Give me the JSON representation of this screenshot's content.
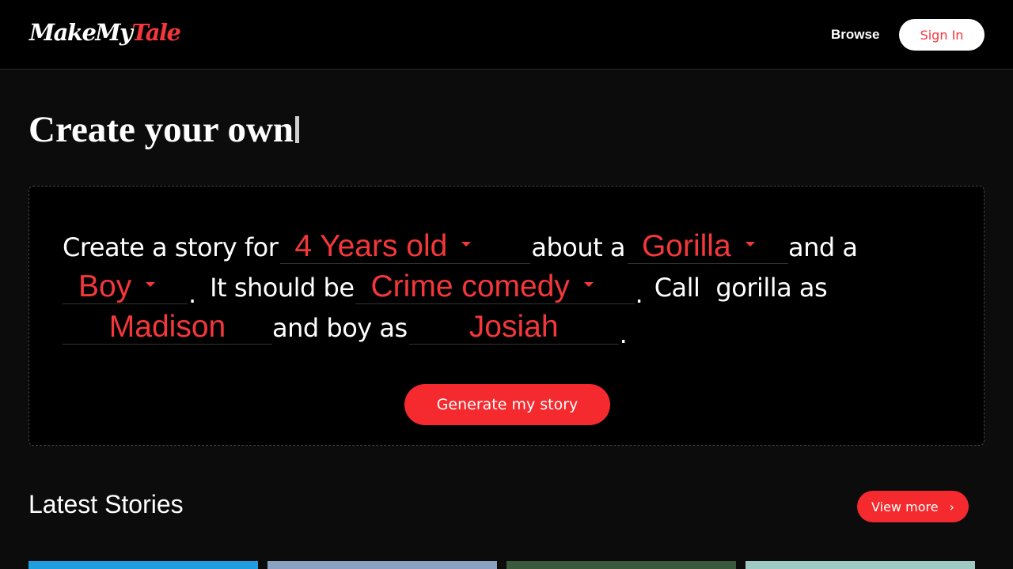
{
  "header": {
    "logo_part1": "MakeMy",
    "logo_part2": "Tale",
    "browse": "Browse",
    "sign_in": "Sign In"
  },
  "hero": {
    "title": "Create your own"
  },
  "story_builder": {
    "text_create": "Create a story for",
    "age": "4 Years old",
    "text_about": "about a",
    "character1": "Gorilla",
    "text_and": "and a",
    "character2": "Boy",
    "text_should": "It should be",
    "genre": "Crime comedy",
    "text_call": "Call",
    "text_char1_as": "gorilla as",
    "name1": "Madison",
    "text_char2_as": "and boy as",
    "name2": "Josiah",
    "period": ".",
    "generate": "Generate my story"
  },
  "latest": {
    "title": "Latest Stories",
    "view_more": "View more"
  },
  "thumbnails": [
    {
      "name": "story-thumbnail-1",
      "color": "#1e9de0"
    },
    {
      "name": "story-thumbnail-2",
      "color": "#8aa2c0"
    },
    {
      "name": "story-thumbnail-3",
      "color": "#3b5a3c"
    },
    {
      "name": "story-thumbnail-4",
      "color": "#9fc9c3"
    }
  ],
  "colors": {
    "accent": "#f4373b",
    "background": "#0c0c0c",
    "header": "#000000"
  }
}
